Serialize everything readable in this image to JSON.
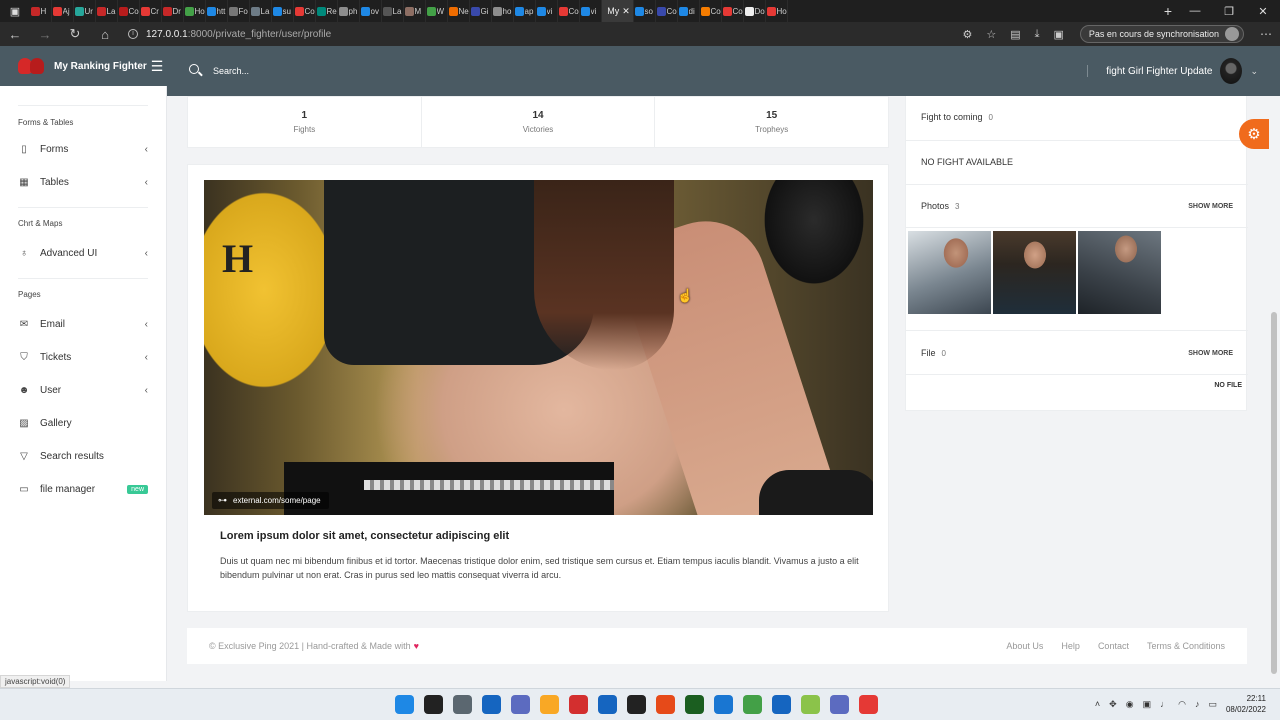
{
  "browser": {
    "tabs": [
      {
        "fav": "#c62828",
        "title": "H"
      },
      {
        "fav": "#e53935",
        "title": "Aj"
      },
      {
        "fav": "#26a69a",
        "title": "Ur"
      },
      {
        "fav": "#c62828",
        "title": "La"
      },
      {
        "fav": "#b71c1c",
        "title": "Co"
      },
      {
        "fav": "#e53935",
        "title": "Cr"
      },
      {
        "fav": "#c62828",
        "title": "Dr"
      },
      {
        "fav": "#43a047",
        "title": "Ho"
      },
      {
        "fav": "#1e88e5",
        "title": "htt"
      },
      {
        "fav": "#777777",
        "title": "Fo"
      },
      {
        "fav": "#6d7b86",
        "title": "La"
      },
      {
        "fav": "#1e88e5",
        "title": "su"
      },
      {
        "fav": "#e53935",
        "title": "Co"
      },
      {
        "fav": "#00897b",
        "title": "Re"
      },
      {
        "fav": "#8d8d8d",
        "title": "ph"
      },
      {
        "fav": "#1e88e5",
        "title": "ov"
      },
      {
        "fav": "#555555",
        "title": "La"
      },
      {
        "fav": "#8d6e63",
        "title": "M"
      },
      {
        "fav": "#43a047",
        "title": "W"
      },
      {
        "fav": "#ef6c00",
        "title": "Ne"
      },
      {
        "fav": "#3949ab",
        "title": "Gi"
      },
      {
        "fav": "#8d8d8d",
        "title": "ho"
      },
      {
        "fav": "#1e88e5",
        "title": "ap"
      },
      {
        "fav": "#1e88e5",
        "title": "vi"
      },
      {
        "fav": "#e53935",
        "title": "Co"
      },
      {
        "fav": "#1e88e5",
        "title": "vi"
      }
    ],
    "active_tab": "My",
    "tabs_after": [
      {
        "fav": "#1e88e5",
        "title": "so"
      },
      {
        "fav": "#3949ab",
        "title": "Co"
      },
      {
        "fav": "#1e88e5",
        "title": "di"
      },
      {
        "fav": "#f57c00",
        "title": "Co"
      },
      {
        "fav": "#e53935",
        "title": "Co"
      },
      {
        "fav": "#eeeeee",
        "title": "Do"
      },
      {
        "fav": "#e53935",
        "title": "Ho"
      }
    ],
    "url_host": "127.0.0.1",
    "url_path": ":8000/private_fighter/user/profile",
    "sync_label": "Pas en cours de synchronisation"
  },
  "app": {
    "brand": "My Ranking Fighter",
    "search_placeholder": "Search...",
    "user_name": "fight Girl Fighter Update"
  },
  "sidebar": {
    "section_forms": "Forms & Tables",
    "forms": "Forms",
    "tables": "Tables",
    "section_charts": "Chrt & Maps",
    "advanced_ui": "Advanced UI",
    "section_pages": "Pages",
    "email": "Email",
    "tickets": "Tickets",
    "user": "User",
    "gallery": "Gallery",
    "search_results": "Search results",
    "file_manager": "file manager",
    "badge_new": "new"
  },
  "stats": [
    {
      "value": "1",
      "label": "Fights"
    },
    {
      "value": "14",
      "label": "Victories"
    },
    {
      "value": "15",
      "label": "Tropheys"
    }
  ],
  "post": {
    "link": "external.com/some/page",
    "title": "Lorem ipsum dolor sit amet, consectetur adipiscing elit",
    "text": "Duis ut quam nec mi bibendum finibus et id tortor. Maecenas tristique dolor enim, sed tristique sem cursus et. Etiam tempus iaculis blandit. Vivamus a justo a elit bibendum pulvinar ut non erat. Cras in purus sed leo mattis consequat viverra id arcu."
  },
  "right": {
    "fight_to_coming": "Fight to coming",
    "fight_count": "0",
    "no_fight": "NO FIGHT AVAILABLE",
    "photos": "Photos",
    "photos_count": "3",
    "show_more": "SHOW MORE",
    "file": "File",
    "file_count": "0",
    "no_file": "NO FILE"
  },
  "footer": {
    "copyright": "© Exclusive Ping 2021 | Hand-crafted & Made with",
    "links": [
      "About Us",
      "Help",
      "Contact",
      "Terms & Conditions"
    ]
  },
  "status_url": "javascript:void(0)",
  "taskbar": {
    "time": "22:11",
    "date": "08/02/2022",
    "icons": [
      "#1e88e5",
      "#222222",
      "#5b6770",
      "#1565c0",
      "#5c6bc0",
      "#f9a825",
      "#d32f2f",
      "#1565c0",
      "#222222",
      "#e64a19",
      "#1b5e20",
      "#1976d2",
      "#43a047",
      "#1565c0",
      "#8bc34a",
      "#5c6bc0",
      "#e53935"
    ]
  }
}
